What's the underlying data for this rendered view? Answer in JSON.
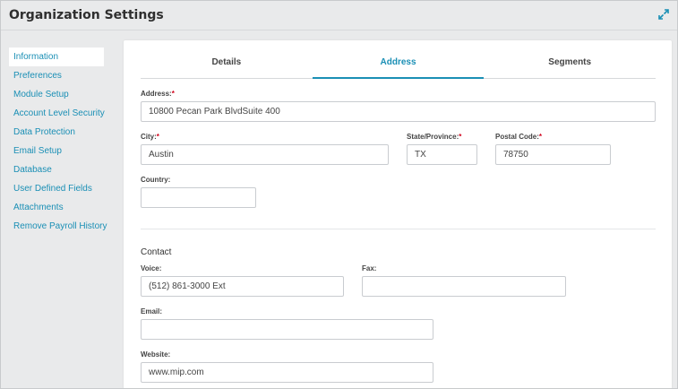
{
  "window": {
    "title": "Organization Settings"
  },
  "sidebar": {
    "items": [
      {
        "label": "Information"
      },
      {
        "label": "Preferences"
      },
      {
        "label": "Module Setup"
      },
      {
        "label": "Account Level Security"
      },
      {
        "label": "Data Protection"
      },
      {
        "label": "Email Setup"
      },
      {
        "label": "Database"
      },
      {
        "label": "User Defined Fields"
      },
      {
        "label": "Attachments"
      },
      {
        "label": "Remove Payroll History"
      }
    ],
    "active_index": 0
  },
  "tabs": [
    {
      "label": "Details"
    },
    {
      "label": "Address"
    },
    {
      "label": "Segments"
    }
  ],
  "active_tab": "Address",
  "address": {
    "address_label": "Address:",
    "address_value": "10800 Pecan Park BlvdSuite 400",
    "city_label": "City:",
    "city_value": "Austin",
    "state_label": "State/Province:",
    "state_value": "TX",
    "postal_label": "Postal Code:",
    "postal_value": "78750",
    "country_label": "Country:",
    "country_value": "",
    "required_mark": "*"
  },
  "contact": {
    "section_title": "Contact",
    "voice_label": "Voice:",
    "voice_value": "(512) 861-3000 Ext",
    "fax_label": "Fax:",
    "fax_value": "",
    "email_label": "Email:",
    "email_value": "",
    "website_label": "Website:",
    "website_value": "www.mip.com"
  },
  "colors": {
    "accent": "#1a8fb5",
    "required": "#d0021b",
    "background": "#e9eaeb"
  },
  "icons": {
    "expand": "expand-icon"
  }
}
